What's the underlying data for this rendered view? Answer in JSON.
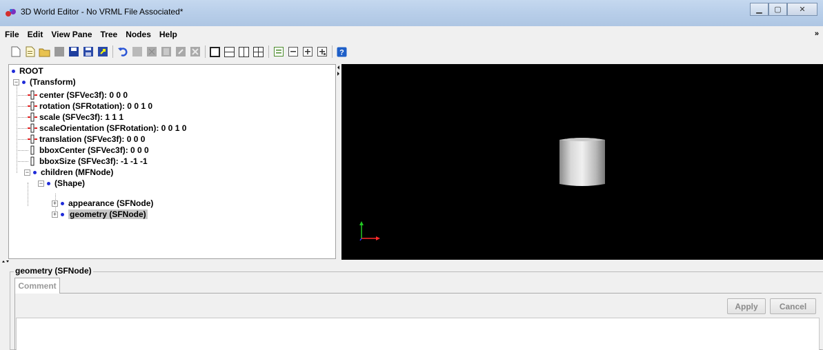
{
  "window": {
    "title": "3D World Editor - No VRML File Associated*",
    "controls": {
      "minimize": "minimize-icon",
      "maximize": "maximize-icon",
      "close": "close-icon"
    }
  },
  "menu": {
    "items": [
      "File",
      "Edit",
      "View Pane",
      "Tree",
      "Nodes",
      "Help"
    ],
    "overflow": "»"
  },
  "toolbar": {
    "icons": [
      "new-icon",
      "new-from-template-icon",
      "open-icon",
      "reload-icon",
      "save-icon",
      "save-as-icon",
      "export-icon",
      "undo-icon",
      "cut-icon",
      "copy-icon",
      "paste-icon",
      "paste-special-icon",
      "delete-icon",
      "single-view-icon",
      "split-horizontal-icon",
      "split-vertical-icon",
      "split-quad-icon",
      "collapse-all-icon",
      "collapse-icon",
      "expand-icon",
      "expand-all-icon",
      "help-icon"
    ]
  },
  "tree": {
    "root": "ROOT",
    "transform": "(Transform)",
    "fields": [
      "center (SFVec3f): 0  0  0",
      "rotation (SFRotation): 0  0  1  0",
      "scale (SFVec3f): 1  1  1",
      "scaleOrientation (SFRotation): 0  0  1  0",
      "translation (SFVec3f): 0  0  0",
      "bboxCenter (SFVec3f): 0  0  0",
      "bboxSize (SFVec3f): -1 -1 -1"
    ],
    "children": "children (MFNode)",
    "shape": "(Shape)",
    "appearance": "appearance (SFNode)",
    "geometry": "geometry (SFNode)"
  },
  "viewport": {
    "background": "#000000",
    "axis_colors": {
      "x": "#ff2a2a",
      "y": "#22c922",
      "z": "#3a3aff"
    }
  },
  "properties": {
    "group_title": "geometry (SFNode)",
    "tab": "Comment",
    "apply": "Apply",
    "cancel": "Cancel",
    "comment_value": ""
  }
}
